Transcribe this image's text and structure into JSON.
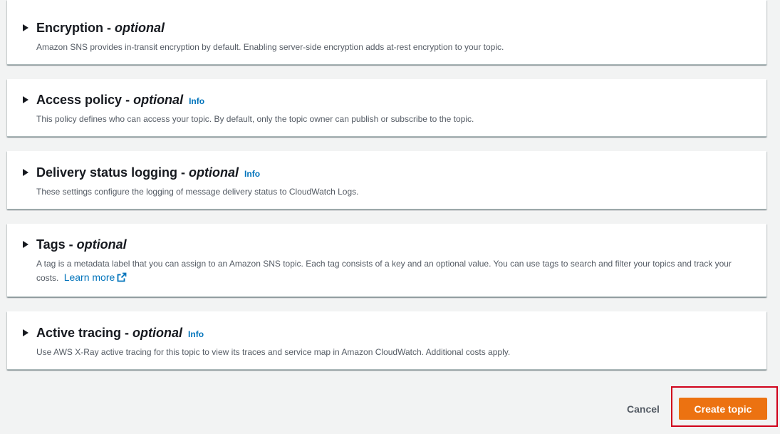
{
  "sections": [
    {
      "title": "Encryption - ",
      "optional": "optional",
      "info": "",
      "description": "Amazon SNS provides in-transit encryption by default. Enabling server-side encryption adds at-rest encryption to your topic."
    },
    {
      "title": "Access policy - ",
      "optional": "optional",
      "info": "Info",
      "description": "This policy defines who can access your topic. By default, only the topic owner can publish or subscribe to the topic."
    },
    {
      "title": "Delivery status logging - ",
      "optional": "optional",
      "info": "Info",
      "description": "These settings configure the logging of message delivery status to CloudWatch Logs."
    },
    {
      "title": "Tags - ",
      "optional": "optional",
      "info": "",
      "description": "A tag is a metadata label that you can assign to an Amazon SNS topic. Each tag consists of a key and an optional value. You can use tags to search and filter your topics and track your costs.",
      "learn_more": "Learn more"
    },
    {
      "title": "Active tracing - ",
      "optional": "optional",
      "info": "Info",
      "description": "Use AWS X-Ray active tracing for this topic to view its traces and service map in Amazon CloudWatch. Additional costs apply."
    }
  ],
  "footer": {
    "cancel_label": "Cancel",
    "create_label": "Create topic"
  },
  "colors": {
    "primary_button": "#ec7211",
    "link": "#0073bb",
    "highlight": "#d0021b"
  }
}
